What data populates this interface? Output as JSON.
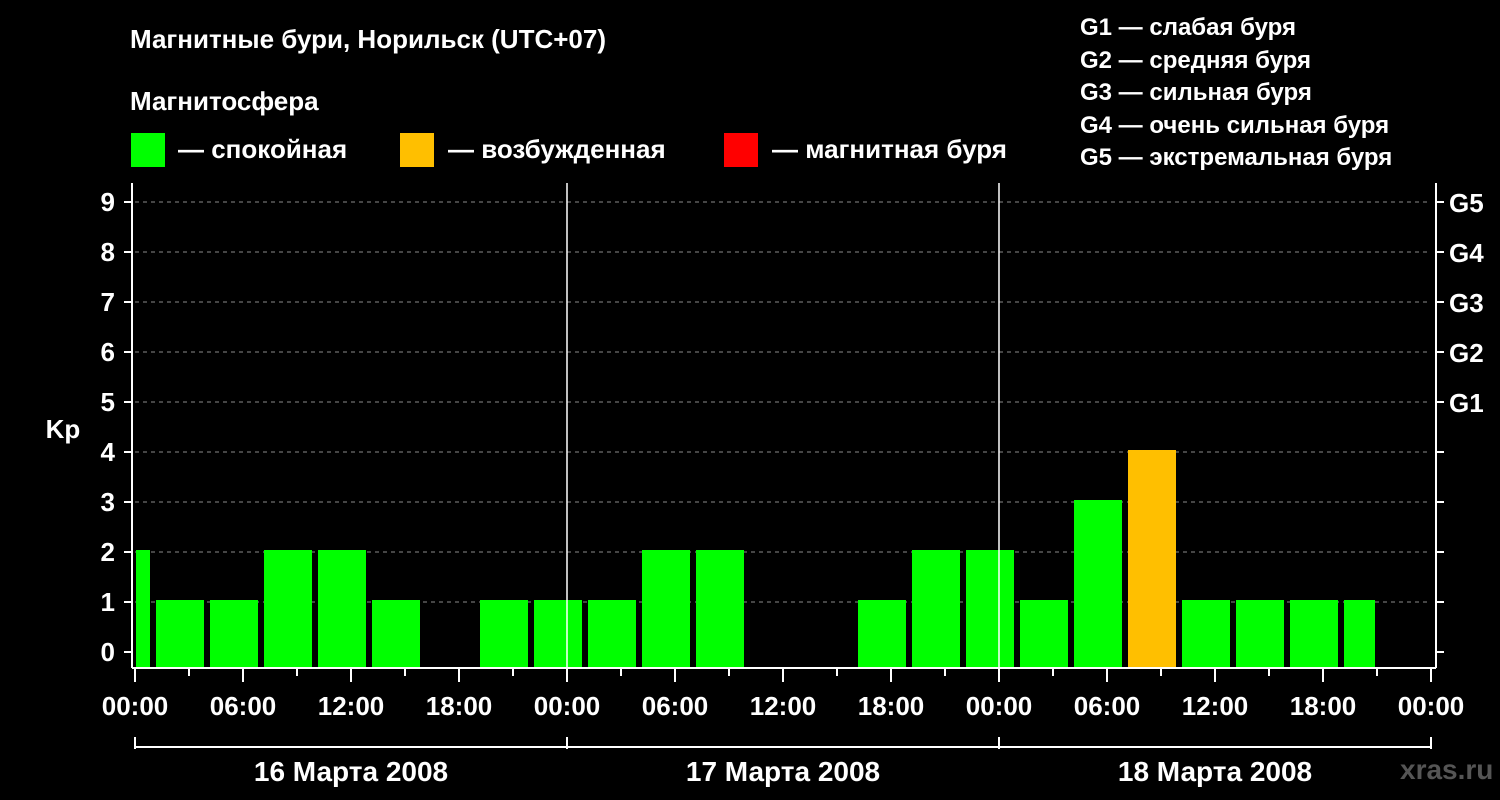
{
  "title": "Магнитные бури, Норильск (UTC+07)",
  "subtitle": "Магнитосфера",
  "legend": [
    {
      "color": "#00ff00",
      "label": "— спокойная"
    },
    {
      "color": "#ffbf00",
      "label": "— возбужденная"
    },
    {
      "color": "#ff0000",
      "label": "— магнитная буря"
    }
  ],
  "storm_levels": [
    "G1 — слабая буря",
    "G2 — средняя буря",
    "G3 — сильная буря",
    "G4 — очень сильная буря",
    "G5 — экстремальная буря"
  ],
  "watermark": "xras.ru",
  "chart_data": {
    "type": "bar",
    "title": "Магнитные бури, Норильск (UTC+07)",
    "ylabel": "Kp",
    "ylim": [
      0,
      9
    ],
    "yticks": [
      0,
      1,
      2,
      3,
      4,
      5,
      6,
      7,
      8,
      9
    ],
    "right_ticks": [
      {
        "value": 5,
        "label": "G1"
      },
      {
        "value": 6,
        "label": "G2"
      },
      {
        "value": 7,
        "label": "G3"
      },
      {
        "value": 8,
        "label": "G4"
      },
      {
        "value": 9,
        "label": "G5"
      }
    ],
    "xlim_hours": [
      0,
      72
    ],
    "xtick_labels": [
      "00:00",
      "06:00",
      "12:00",
      "18:00",
      "00:00",
      "06:00",
      "12:00",
      "18:00",
      "00:00",
      "06:00",
      "12:00",
      "18:00",
      "00:00"
    ],
    "days": [
      "16 Марта 2008",
      "17 Марта 2008",
      "18 Марта 2008"
    ],
    "bars": [
      {
        "start_hour": 0,
        "end_hour": 1,
        "kp": 2,
        "state": "спокойная"
      },
      {
        "start_hour": 1,
        "end_hour": 4,
        "kp": 1,
        "state": "спокойная"
      },
      {
        "start_hour": 4,
        "end_hour": 7,
        "kp": 1,
        "state": "спокойная"
      },
      {
        "start_hour": 7,
        "end_hour": 10,
        "kp": 2,
        "state": "спокойная"
      },
      {
        "start_hour": 10,
        "end_hour": 13,
        "kp": 2,
        "state": "спокойная"
      },
      {
        "start_hour": 13,
        "end_hour": 16,
        "kp": 1,
        "state": "спокойная"
      },
      {
        "start_hour": 16,
        "end_hour": 19,
        "kp": 0,
        "state": "спокойная"
      },
      {
        "start_hour": 19,
        "end_hour": 22,
        "kp": 1,
        "state": "спокойная"
      },
      {
        "start_hour": 22,
        "end_hour": 25,
        "kp": 1,
        "state": "спокойная"
      },
      {
        "start_hour": 25,
        "end_hour": 28,
        "kp": 1,
        "state": "спокойная"
      },
      {
        "start_hour": 28,
        "end_hour": 31,
        "kp": 2,
        "state": "спокойная"
      },
      {
        "start_hour": 31,
        "end_hour": 34,
        "kp": 2,
        "state": "спокойная"
      },
      {
        "start_hour": 34,
        "end_hour": 37,
        "kp": 0,
        "state": "спокойная"
      },
      {
        "start_hour": 37,
        "end_hour": 40,
        "kp": 0,
        "state": "спокойная"
      },
      {
        "start_hour": 40,
        "end_hour": 43,
        "kp": 1,
        "state": "спокойная"
      },
      {
        "start_hour": 43,
        "end_hour": 46,
        "kp": 2,
        "state": "спокойная"
      },
      {
        "start_hour": 46,
        "end_hour": 49,
        "kp": 2,
        "state": "спокойная"
      },
      {
        "start_hour": 49,
        "end_hour": 52,
        "kp": 1,
        "state": "спокойная"
      },
      {
        "start_hour": 52,
        "end_hour": 55,
        "kp": 3,
        "state": "спокойная"
      },
      {
        "start_hour": 55,
        "end_hour": 58,
        "kp": 4,
        "state": "возбужденная"
      },
      {
        "start_hour": 58,
        "end_hour": 61,
        "kp": 1,
        "state": "спокойная"
      },
      {
        "start_hour": 61,
        "end_hour": 64,
        "kp": 1,
        "state": "спокойная"
      },
      {
        "start_hour": 64,
        "end_hour": 67,
        "kp": 1,
        "state": "спокойная"
      },
      {
        "start_hour": 67,
        "end_hour": 69,
        "kp": 1,
        "state": "спокойная"
      }
    ],
    "colors": {
      "спокойная": "#00ff00",
      "возбужденная": "#ffbf00",
      "магнитная буря": "#ff0000"
    },
    "grid": "dashed horizontal at each Kp level, solid vertical at day boundaries"
  }
}
